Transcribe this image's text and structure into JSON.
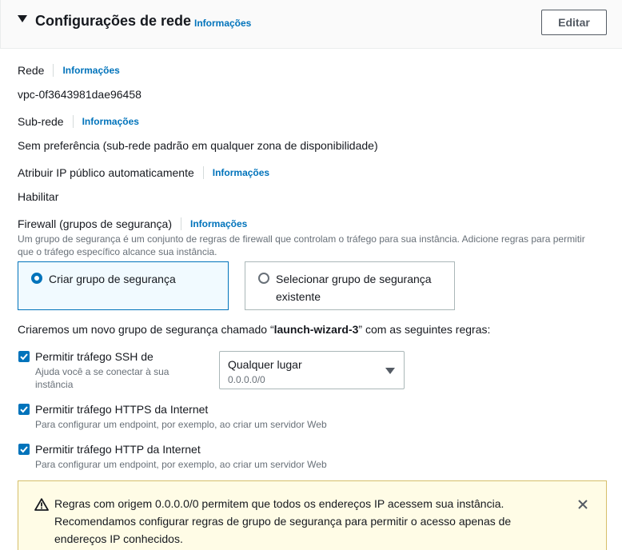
{
  "section": {
    "title": "Configurações de rede",
    "info": "Informações",
    "edit_label": "Editar"
  },
  "network": {
    "label": "Rede",
    "info": "Informações",
    "value": "vpc-0f3643981dae96458"
  },
  "subnet": {
    "label": "Sub-rede",
    "info": "Informações",
    "value": "Sem preferência (sub-rede padrão em qualquer zona de disponibilidade)"
  },
  "public_ip": {
    "label": "Atribuir IP público automaticamente",
    "info": "Informações",
    "value": "Habilitar"
  },
  "firewall": {
    "label": "Firewall (grupos de segurança)",
    "info": "Informações",
    "description_line1": "Um grupo de segurança é um conjunto de regras de firewall que controlam o tráfego para sua instância. Adicione regras para permitir",
    "description_line2": "que o tráfego específico alcance sua instância.",
    "option_create": "Criar grupo de segurança",
    "option_select_line1": "Selecionar grupo de segurança",
    "option_select_line2": "existente",
    "selected_option": "create"
  },
  "rules": {
    "intro_prefix": "Criaremos um novo grupo de segurança chamado “",
    "group_name": "launch-wizard-3",
    "intro_suffix": "” com as seguintes regras:",
    "ssh": {
      "label": "Permitir tráfego SSH de",
      "desc_line1": "Ajuda você a se conectar à sua",
      "desc_line2": "instância",
      "checked": true,
      "source_main": "Qualquer lugar",
      "source_sub": "0.0.0.0/0"
    },
    "https": {
      "label": "Permitir tráfego HTTPS da Internet",
      "desc": "Para configurar um endpoint, por exemplo, ao criar um servidor Web",
      "checked": true
    },
    "http": {
      "label": "Permitir tráfego HTTP da Internet",
      "desc": "Para configurar um endpoint, por exemplo, ao criar um servidor Web",
      "checked": true
    }
  },
  "warning": {
    "line1": "Regras com origem 0.0.0.0/0 permitem que todos os endereços IP acessem sua instância.",
    "line2": "Recomendamos configurar regras de grupo de segurança para permitir o acesso apenas de",
    "line3": "endereços IP conhecidos."
  },
  "colors": {
    "link": "#0073bb",
    "warning_bg": "#fffce6",
    "warning_border": "#d6bf6a",
    "selected_tile_bg": "#f1faff"
  }
}
